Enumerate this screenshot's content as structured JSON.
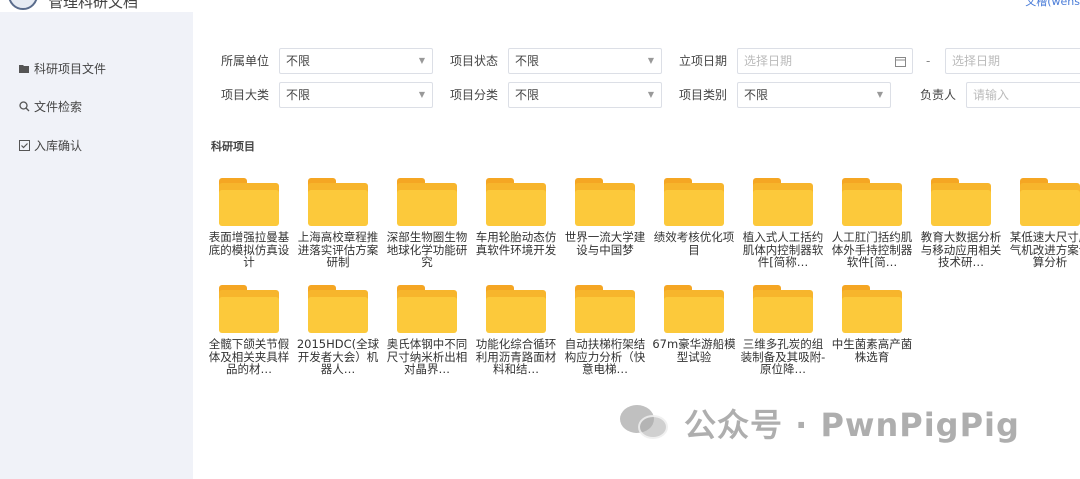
{
  "app": {
    "title": "管理科研文档",
    "user_link": "文槽(wens"
  },
  "sidebar": {
    "items": [
      {
        "label": "科研项目文件",
        "icon": "folder-icon"
      },
      {
        "label": "文件检索",
        "icon": "search-icon"
      },
      {
        "label": "入库确认",
        "icon": "checkbox-icon"
      }
    ]
  },
  "filters": {
    "unit": {
      "label": "所属单位",
      "value": "不限"
    },
    "status": {
      "label": "项目状态",
      "value": "不限"
    },
    "date": {
      "label": "立项日期",
      "start_placeholder": "选择日期",
      "end_placeholder": "选择日期",
      "separator": "-"
    },
    "category": {
      "label": "项目大类",
      "value": "不限"
    },
    "classification": {
      "label": "项目分类",
      "value": "不限"
    },
    "type": {
      "label": "项目类别",
      "value": "不限"
    },
    "owner": {
      "label": "负责人",
      "placeholder": "请输入"
    }
  },
  "section": {
    "title": "科研项目"
  },
  "folders": [
    {
      "name": "表面增强拉曼基底的模拟仿真设计"
    },
    {
      "name": "上海高校章程推进落实评估方案研制"
    },
    {
      "name": "深部生物圈生物地球化学功能研究"
    },
    {
      "name": "车用轮胎动态仿真软件环境开发"
    },
    {
      "name": "世界一流大学建设与中国梦"
    },
    {
      "name": "绩效考核优化项目"
    },
    {
      "name": "植入式人工括约肌体内控制器软件[简称…"
    },
    {
      "name": "人工肛门括约肌体外手持控制器软件[简…"
    },
    {
      "name": "教育大数据分析与移动应用相关技术研…"
    },
    {
      "name": "某低速大尺寸压气机改进方案计算分析"
    },
    {
      "name": "全髋下颌关节假体及相关夹具样品的材…"
    },
    {
      "name": "2015HDC(全球开发者大会）机器人…"
    },
    {
      "name": "奥氏体钢中不同尺寸纳米析出相对晶界…"
    },
    {
      "name": "功能化综合循环利用沥青路面材料和结…"
    },
    {
      "name": "自动扶梯桁架结构应力分析（快意电梯…"
    },
    {
      "name": "67m豪华游船模型试验"
    },
    {
      "name": "三维多孔炭的组装制备及其吸附-原位降…"
    },
    {
      "name": "中生菌素高产菌株选育"
    }
  ],
  "watermark": {
    "text": "公众号 · PwnPigPig"
  }
}
